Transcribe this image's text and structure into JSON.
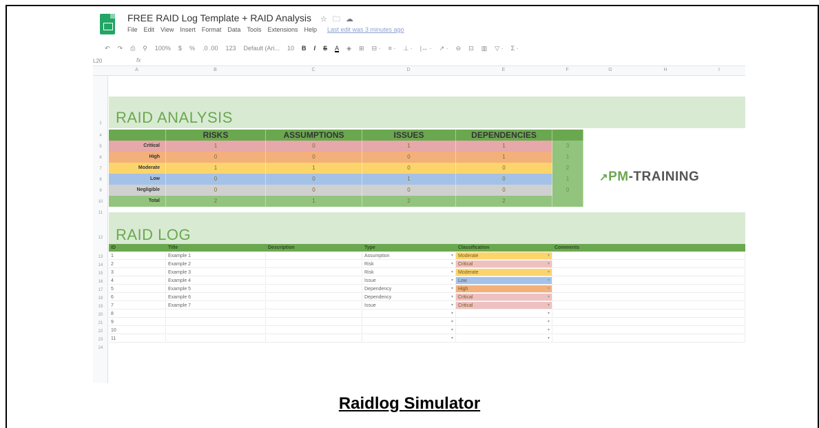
{
  "app": {
    "doc_title": "FREE RAID Log Template + RAID Analysis",
    "title_icons": [
      "star-icon",
      "folder-icon",
      "cloud-icon"
    ],
    "menu": [
      "File",
      "Edit",
      "View",
      "Insert",
      "Format",
      "Data",
      "Tools",
      "Extensions",
      "Help"
    ],
    "last_edit": "Last edit was 3 minutes ago"
  },
  "toolbar": {
    "zoom": "100%",
    "currency": "$",
    "percent": "%",
    "decimals": ".0 .00",
    "number_format": "123",
    "font": "Default (Ari...",
    "font_size": "10",
    "bold": "B",
    "italic": "I",
    "strike": "S",
    "text_color": "A"
  },
  "formula_bar": {
    "cell_ref": "L20",
    "fx": "fx"
  },
  "columns": [
    "A",
    "B",
    "C",
    "D",
    "E",
    "F",
    "G",
    "H",
    "I"
  ],
  "analysis": {
    "title": "RAID ANALYSIS",
    "headers": [
      "RISKS",
      "ASSUMPTIONS",
      "ISSUES",
      "DEPENDENCIES"
    ],
    "rows": [
      {
        "label": "Critical",
        "values": [
          "1",
          "0",
          "1",
          "1"
        ],
        "sum": "3",
        "color": "#e6a8a8"
      },
      {
        "label": "High",
        "values": [
          "0",
          "0",
          "0",
          "1"
        ],
        "sum": "1",
        "color": "#f3b07a"
      },
      {
        "label": "Moderate",
        "values": [
          "1",
          "1",
          "0",
          "0"
        ],
        "sum": "2",
        "color": "#fbd46b"
      },
      {
        "label": "Low",
        "values": [
          "0",
          "0",
          "1",
          "0"
        ],
        "sum": "1",
        "color": "#a4c2e8"
      },
      {
        "label": "Negligible",
        "values": [
          "0",
          "0",
          "0",
          "0"
        ],
        "sum": "0",
        "color": "#d0d0d0"
      },
      {
        "label": "Total",
        "values": [
          "2",
          "1",
          "2",
          "2"
        ],
        "sum": "",
        "color": "#93c47d"
      }
    ]
  },
  "logo": {
    "arrow": "↗",
    "pm": "PM",
    "rest": "-TRAINING"
  },
  "log": {
    "title": "RAID LOG",
    "headers": [
      "ID",
      "Title",
      "Description",
      "Type",
      "Classification",
      "Comments"
    ],
    "rows": [
      {
        "id": "1",
        "title": "Example 1",
        "type": "Assumption",
        "classification": "Moderate",
        "color": "#fbd46b"
      },
      {
        "id": "2",
        "title": "Example 2",
        "type": "Risk",
        "classification": "Critical",
        "color": "#efc0c0"
      },
      {
        "id": "3",
        "title": "Example 3",
        "type": "Risk",
        "classification": "Moderate",
        "color": "#fbd46b"
      },
      {
        "id": "4",
        "title": "Example 4",
        "type": "Issue",
        "classification": "Low",
        "color": "#a4c2e8"
      },
      {
        "id": "5",
        "title": "Example 5",
        "type": "Dependency",
        "classification": "High",
        "color": "#f3b07a"
      },
      {
        "id": "6",
        "title": "Example 6",
        "type": "Dependency",
        "classification": "Critical",
        "color": "#efc0c0"
      },
      {
        "id": "7",
        "title": "Example 7",
        "type": "Issue",
        "classification": "Critical",
        "color": "#efc0c0"
      },
      {
        "id": "8",
        "title": "",
        "type": "",
        "classification": "",
        "color": ""
      },
      {
        "id": "9",
        "title": "",
        "type": "",
        "classification": "",
        "color": ""
      },
      {
        "id": "10",
        "title": "",
        "type": "",
        "classification": "",
        "color": ""
      },
      {
        "id": "11",
        "title": "",
        "type": "",
        "classification": "",
        "color": ""
      }
    ]
  },
  "row_numbers": [
    "1",
    "4",
    "5",
    "6",
    "7",
    "8",
    "9",
    "10",
    "11",
    "12",
    "13",
    "14",
    "15",
    "16",
    "17",
    "18",
    "19",
    "20",
    "21",
    "22",
    "23",
    "24"
  ],
  "caption": "Raidlog Simulator"
}
